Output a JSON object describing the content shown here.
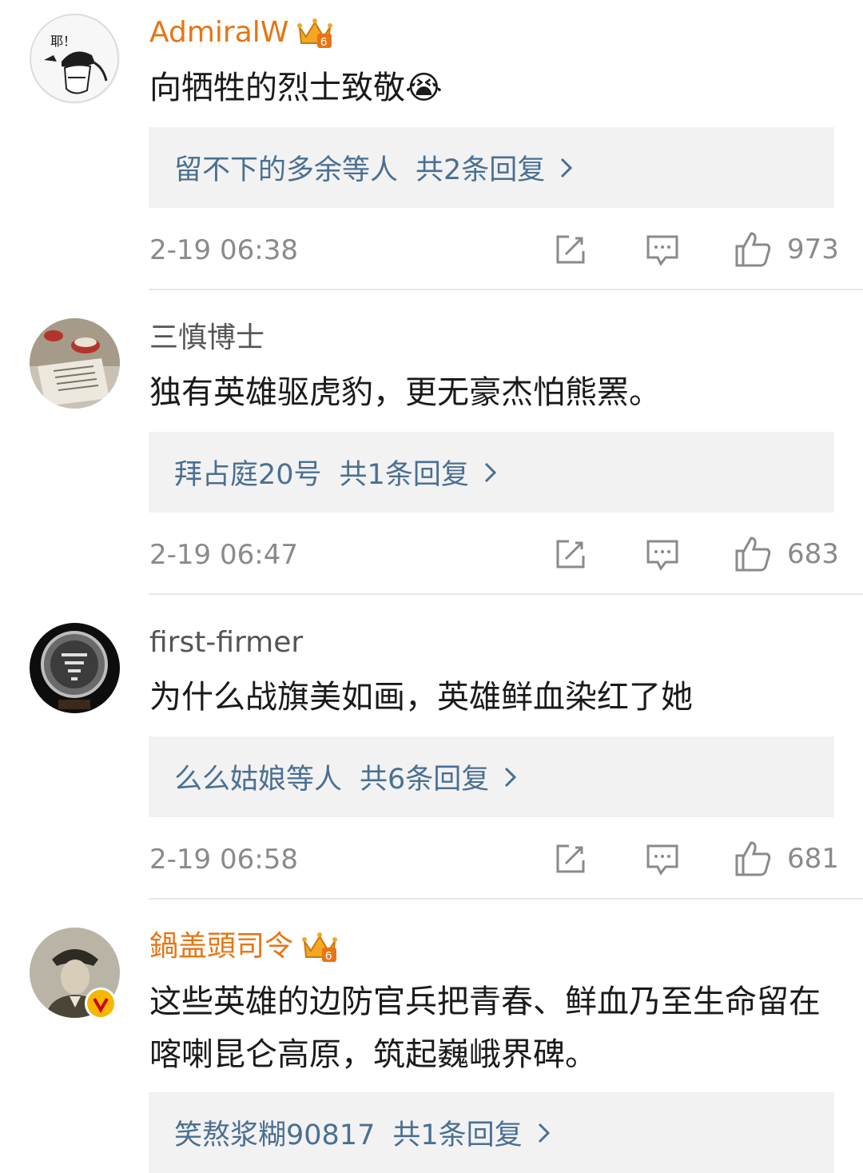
{
  "comments": [
    {
      "username": "AdmiralW",
      "vip": true,
      "crown_level": "6",
      "text": "向牺牲的烈士致敬😭",
      "replies_who": "留不下的多余等人",
      "replies_count": "共2条回复",
      "time": "2-19 06:38",
      "likes": "973"
    },
    {
      "username": "三慎博士",
      "vip": false,
      "text": "独有英雄驱虎豹，更无豪杰怕熊罴。",
      "replies_who": "拜占庭20号",
      "replies_count": "共1条回复",
      "time": "2-19 06:47",
      "likes": "683"
    },
    {
      "username": "first-firmer",
      "vip": false,
      "text": "为什么战旗美如画，英雄鲜血染红了她",
      "replies_who": "么么姑娘等人",
      "replies_count": "共6条回复",
      "time": "2-19 06:58",
      "likes": "681"
    },
    {
      "username": "鍋盖頭司令",
      "vip": true,
      "crown_level": "6",
      "verified": true,
      "text": "这些英雄的边防官兵把青春、鲜血乃至生命留在喀喇昆仑高原，筑起巍峨界碑。",
      "replies_who": "笑熬浆糊90817",
      "replies_count": "共1条回复"
    }
  ],
  "avatar1_text": "耶！",
  "colors": {
    "vip_name": "#e77513",
    "reply_link": "#4a6f92",
    "meta_gray": "#8a8a8a",
    "reply_bg": "#f2f2f2"
  },
  "icons": [
    "repost-icon",
    "comment-icon",
    "like-icon",
    "chevron-right-icon",
    "crown-icon",
    "verified-badge-icon"
  ]
}
